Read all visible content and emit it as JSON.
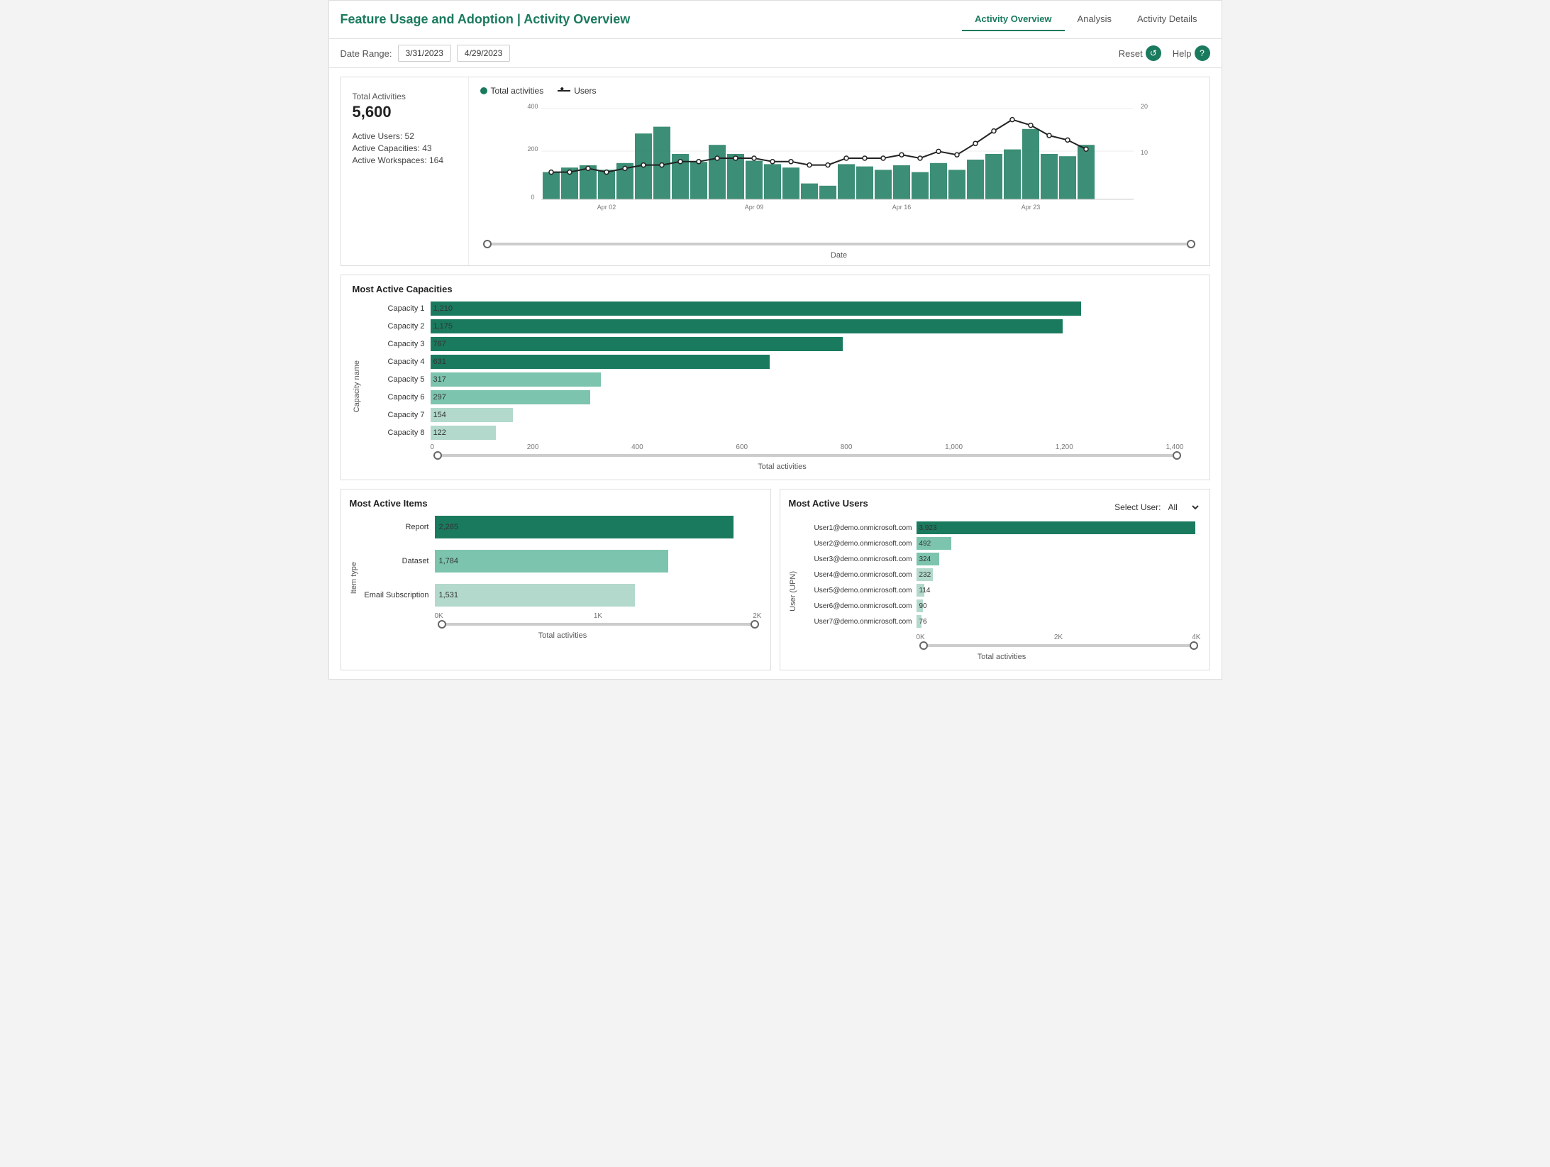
{
  "header": {
    "title": "Feature Usage and Adoption | Activity Overview",
    "nav": [
      {
        "id": "activity-overview",
        "label": "Activity Overview",
        "active": true
      },
      {
        "id": "analysis",
        "label": "Analysis",
        "active": false
      },
      {
        "id": "activity-details",
        "label": "Activity Details",
        "active": false
      }
    ]
  },
  "toolbar": {
    "date_range_label": "Date Range:",
    "date_start": "3/31/2023",
    "date_end": "4/29/2023",
    "reset_label": "Reset",
    "help_label": "Help"
  },
  "summary": {
    "total_activities_label": "Total Activities",
    "total_activities_value": "5,600",
    "active_users_label": "Active Users:",
    "active_users_value": "52",
    "active_capacities_label": "Active Capacities:",
    "active_capacities_value": "43",
    "active_workspaces_label": "Active Workspaces:",
    "active_workspaces_value": "164"
  },
  "time_chart": {
    "legend_activities": "Total activities",
    "legend_users": "Users",
    "y_left_label": "Total activities",
    "y_right_label": "Users",
    "x_label": "Date",
    "x_ticks": [
      "Apr 02",
      "Apr 09",
      "Apr 16",
      "Apr 23"
    ],
    "y_left_ticks": [
      "0",
      "200",
      "400"
    ],
    "y_right_ticks": [
      "10",
      "20"
    ],
    "bars": [
      {
        "date": "Mar31",
        "value": 120
      },
      {
        "date": "Apr01",
        "value": 140
      },
      {
        "date": "Apr02",
        "value": 150
      },
      {
        "date": "Apr03",
        "value": 130
      },
      {
        "date": "Apr04",
        "value": 160
      },
      {
        "date": "Apr05",
        "value": 290
      },
      {
        "date": "Apr06",
        "value": 320
      },
      {
        "date": "Apr07",
        "value": 200
      },
      {
        "date": "Apr08",
        "value": 165
      },
      {
        "date": "Apr09",
        "value": 240
      },
      {
        "date": "Apr10",
        "value": 200
      },
      {
        "date": "Apr11",
        "value": 170
      },
      {
        "date": "Apr12",
        "value": 155
      },
      {
        "date": "Apr13",
        "value": 140
      },
      {
        "date": "Apr14",
        "value": 70
      },
      {
        "date": "Apr15",
        "value": 60
      },
      {
        "date": "Apr16",
        "value": 155
      },
      {
        "date": "Apr17",
        "value": 145
      },
      {
        "date": "Apr18",
        "value": 130
      },
      {
        "date": "Apr19",
        "value": 150
      },
      {
        "date": "Apr20",
        "value": 120
      },
      {
        "date": "Apr21",
        "value": 160
      },
      {
        "date": "Apr22",
        "value": 130
      },
      {
        "date": "Apr23",
        "value": 175
      },
      {
        "date": "Apr24",
        "value": 200
      },
      {
        "date": "Apr25",
        "value": 220
      },
      {
        "date": "Apr26",
        "value": 310
      },
      {
        "date": "Apr27",
        "value": 200
      },
      {
        "date": "Apr28",
        "value": 190
      },
      {
        "date": "Apr29",
        "value": 240
      }
    ],
    "user_line": [
      6,
      6,
      7,
      6,
      7,
      8,
      8,
      9,
      9,
      10,
      10,
      10,
      9,
      9,
      8,
      8,
      10,
      10,
      10,
      11,
      10,
      12,
      11,
      14,
      17,
      19,
      18,
      16,
      15,
      13
    ]
  },
  "capacities": {
    "title": "Most Active Capacities",
    "y_axis_label": "Capacity name",
    "x_axis_label": "Total activities",
    "x_ticks": [
      "0",
      "200",
      "400",
      "600",
      "800",
      "1,000",
      "1,200",
      "1,400"
    ],
    "max_value": 1400,
    "items": [
      {
        "name": "Capacity 1",
        "value": 1210,
        "color": "#1a7a5e"
      },
      {
        "name": "Capacity 2",
        "value": 1175,
        "color": "#1a7a5e"
      },
      {
        "name": "Capacity 3",
        "value": 767,
        "color": "#1a7a5e"
      },
      {
        "name": "Capacity 4",
        "value": 631,
        "color": "#1a7a5e"
      },
      {
        "name": "Capacity 5",
        "value": 317,
        "color": "#7cc4ae"
      },
      {
        "name": "Capacity 6",
        "value": 297,
        "color": "#7cc4ae"
      },
      {
        "name": "Capacity 7",
        "value": 154,
        "color": "#b2d9cc"
      },
      {
        "name": "Capacity 8",
        "value": 122,
        "color": "#b2d9cc"
      }
    ]
  },
  "active_items": {
    "title": "Most Active Items",
    "y_axis_label": "Item type",
    "x_axis_label": "Total activities",
    "x_ticks": [
      "0K",
      "1K",
      "2K"
    ],
    "max_value": 2500,
    "items": [
      {
        "name": "Report",
        "value": 2285,
        "color": "#1a7a5e"
      },
      {
        "name": "Dataset",
        "value": 1784,
        "color": "#7cc4ae"
      },
      {
        "name": "Email Subscription",
        "value": 1531,
        "color": "#b2d9cc"
      }
    ]
  },
  "active_users": {
    "title": "Most Active Users",
    "select_user_label": "Select User:",
    "select_user_value": "All",
    "y_axis_label": "User (UPN)",
    "x_axis_label": "Total activities",
    "x_ticks": [
      "0K",
      "2K",
      "4K"
    ],
    "max_value": 4000,
    "items": [
      {
        "name": "User1@demo.onmicrosoft.com",
        "value": 3923,
        "color": "#1a7a5e"
      },
      {
        "name": "User2@demo.onmicrosoft.com",
        "value": 492,
        "color": "#7cc4ae"
      },
      {
        "name": "User3@demo.onmicrosoft.com",
        "value": 324,
        "color": "#7cc4ae"
      },
      {
        "name": "User4@demo.onmicrosoft.com",
        "value": 232,
        "color": "#b2d9cc"
      },
      {
        "name": "User5@demo.onmicrosoft.com",
        "value": 114,
        "color": "#b2d9cc"
      },
      {
        "name": "User6@demo.onmicrosoft.com",
        "value": 90,
        "color": "#b2d9cc"
      },
      {
        "name": "User7@demo.onmicrosoft.com",
        "value": 76,
        "color": "#b2d9cc"
      }
    ]
  },
  "colors": {
    "brand_green": "#1a7a5e",
    "light_green": "#7cc4ae",
    "lighter_green": "#b2d9cc"
  }
}
